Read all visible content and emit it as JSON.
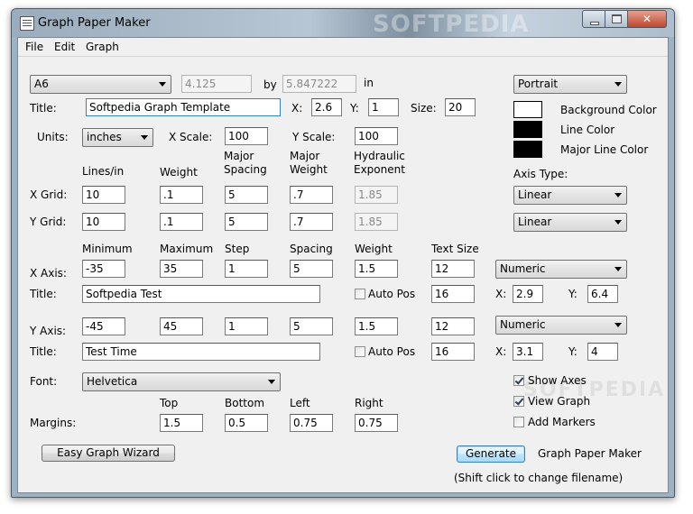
{
  "window": {
    "title": "Graph Paper Maker",
    "watermark": "SOFTPEDIA"
  },
  "menu": [
    "File",
    "Edit",
    "Graph"
  ],
  "page": {
    "size_value": "A6",
    "width": "4.125",
    "by_label": "by",
    "height": "5.847222",
    "unit_label": "in",
    "orientation": "Portrait"
  },
  "title_row": {
    "title_label": "Title:",
    "title_value": "Softpedia Graph Template",
    "x_label": "X:",
    "x_value": "2.6",
    "y_label": "Y:",
    "y_value": "1",
    "size_label": "Size:",
    "size_value": "20"
  },
  "units_row": {
    "units_label": "Units:",
    "units_value": "inches",
    "xscale_label": "X Scale:",
    "xscale_value": "100",
    "yscale_label": "Y Scale:",
    "yscale_value": "100"
  },
  "colors": {
    "background_label": "Background Color",
    "background_color": "#ffffff",
    "line_label": "Line Color",
    "line_color": "#000000",
    "major_line_label": "Major Line Color",
    "major_line_color": "#000000"
  },
  "grid": {
    "headers": [
      "Lines/in",
      "Weight",
      "Major Spacing",
      "Major Weight",
      "Hydraulic Exponent"
    ],
    "rows": [
      {
        "label": "X Grid:",
        "values": [
          "10",
          ".1",
          "5",
          ".7",
          "1.85"
        ]
      },
      {
        "label": "Y Grid:",
        "values": [
          "10",
          ".1",
          "5",
          ".7",
          "1.85"
        ]
      }
    ]
  },
  "axis_type": {
    "label": "Axis Type:",
    "x_value": "Linear",
    "y_value": "Linear"
  },
  "axes": {
    "headers": [
      "Minimum",
      "Maximum",
      "Step",
      "Spacing",
      "Weight",
      "Text Size"
    ],
    "x_axis": {
      "label": "X Axis:",
      "values": [
        "-35",
        "35",
        "1",
        "5",
        "1.5",
        "12"
      ],
      "format": "Numeric",
      "title_label": "Title:",
      "title_value": "Softpedia Test",
      "auto_pos_label": "Auto Pos",
      "auto_pos_checked": false,
      "title_size": "16",
      "x_label": "X:",
      "x_value": "2.9",
      "y_label": "Y:",
      "y_value": "6.4"
    },
    "y_axis": {
      "label": "Y Axis:",
      "values": [
        "-45",
        "45",
        "1",
        "5",
        "1.5",
        "12"
      ],
      "format": "Numeric",
      "title_label": "Title:",
      "title_value": "Test Time",
      "auto_pos_label": "Auto Pos",
      "auto_pos_checked": false,
      "title_size": "16",
      "x_label": "X:",
      "x_value": "3.1",
      "y_label": "Y:",
      "y_value": "4"
    }
  },
  "font": {
    "label": "Font:",
    "value": "Helvetica"
  },
  "margins": {
    "label": "Margins:",
    "headers": [
      "Top",
      "Bottom",
      "Left",
      "Right"
    ],
    "values": [
      "1.5",
      "0.5",
      "0.75",
      "0.75"
    ]
  },
  "options": {
    "show_axes_label": "Show Axes",
    "show_axes_checked": true,
    "view_graph_label": "View Graph",
    "view_graph_checked": true,
    "add_markers_label": "Add Markers",
    "add_markers_checked": false
  },
  "buttons": {
    "wizard": "Easy Graph Wizard",
    "generate": "Generate",
    "generate_caption": "Graph Paper Maker",
    "hint": "(Shift click to change filename)"
  }
}
